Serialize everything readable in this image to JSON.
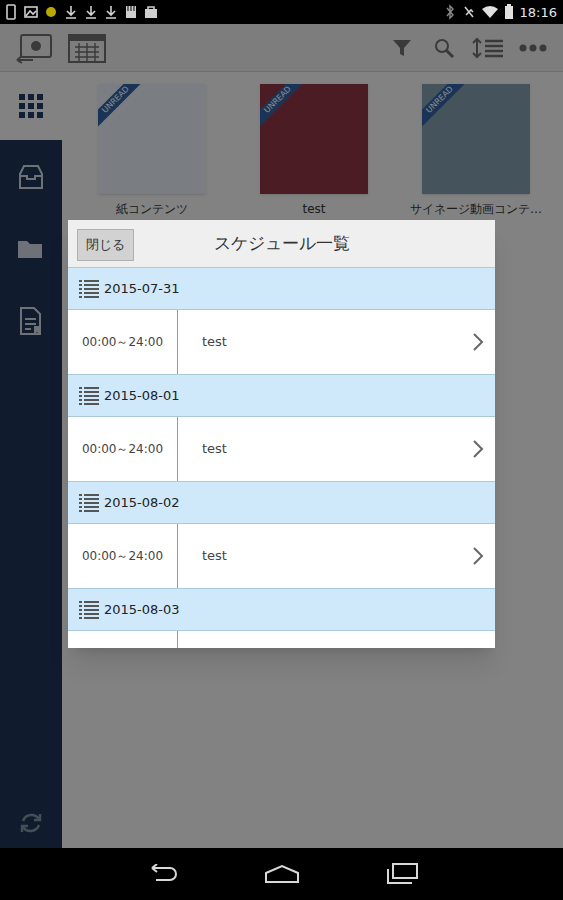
{
  "status_bar": {
    "time": "18:16"
  },
  "thumbnails": [
    {
      "label": "紙コンテンツ",
      "badge": "UNREAD",
      "color": "#dfe6ee"
    },
    {
      "label": "test",
      "badge": "UNREAD",
      "color": "#8a3444"
    },
    {
      "label": "サイネージ動画コンテ…",
      "badge": "UNREAD",
      "color": "#7f98aa"
    }
  ],
  "dialog": {
    "close_button": "閉じる",
    "title": "スケジュール一覧",
    "schedule": [
      {
        "date": "2015-07-31",
        "entries": [
          {
            "time": "00:00～24:00",
            "title": "test"
          }
        ]
      },
      {
        "date": "2015-08-01",
        "entries": [
          {
            "time": "00:00～24:00",
            "title": "test"
          }
        ]
      },
      {
        "date": "2015-08-02",
        "entries": [
          {
            "time": "00:00～24:00",
            "title": "test"
          }
        ]
      },
      {
        "date": "2015-08-03",
        "entries": []
      }
    ]
  }
}
